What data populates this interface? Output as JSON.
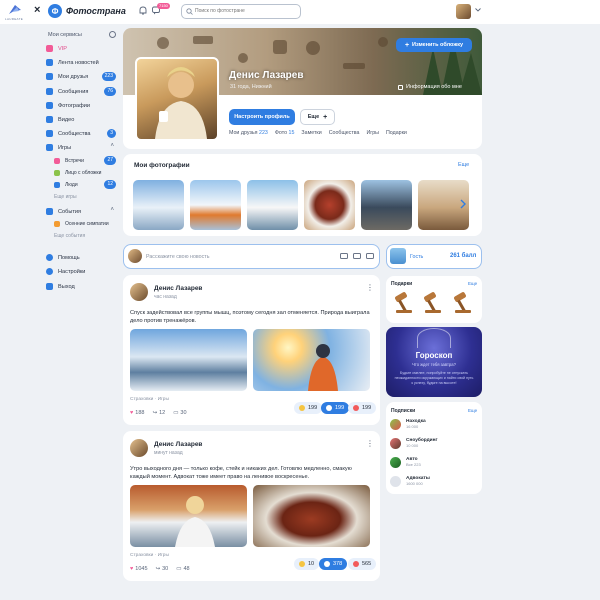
{
  "header": {
    "logo_text": "Фотострана",
    "notif_count": "7150",
    "search_placeholder": "Поиск по фотостране",
    "partner_caption": "LAUREATE"
  },
  "sidebar": {
    "title": "Мои сервисы",
    "items": [
      {
        "label": "VIP",
        "badge": ""
      },
      {
        "label": "Лента новостей",
        "badge": ""
      },
      {
        "label": "Мои друзья",
        "badge": "223"
      },
      {
        "label": "Сообщения",
        "badge": "76"
      },
      {
        "label": "Фотографии",
        "badge": ""
      },
      {
        "label": "Видео",
        "badge": ""
      },
      {
        "label": "Сообщества",
        "badge": "3"
      },
      {
        "label": "Игры",
        "badge": ""
      }
    ],
    "games": [
      {
        "label": "Встречи",
        "badge": "27"
      },
      {
        "label": "Лицо с обложки",
        "badge": ""
      },
      {
        "label": "Люди",
        "badge": "12"
      }
    ],
    "more_games": "Еще игры",
    "events_title": "События",
    "events": [
      {
        "label": "Осенние симпатии"
      }
    ],
    "more_events": "Еще события",
    "bottom": [
      {
        "label": "Помощь"
      },
      {
        "label": "Настройки"
      },
      {
        "label": "Выход"
      }
    ]
  },
  "profile": {
    "name": "Денис Лазарев",
    "info": "31 года, Нижний",
    "cover_button": "Изменить обложку",
    "profile_info_link": "Информация обо мне",
    "setup_button": "Настроить профиль",
    "more_button": "Еще",
    "tabs": [
      {
        "label": "Мои друзья",
        "count": "223"
      },
      {
        "label": "Фото",
        "count": "15"
      },
      {
        "label": "Заметки",
        "count": ""
      },
      {
        "label": "Сообщества",
        "count": ""
      },
      {
        "label": "Игры",
        "count": ""
      },
      {
        "label": "Подарки",
        "count": ""
      }
    ]
  },
  "photos": {
    "title": "Мои фотографии",
    "all_link": "Еще"
  },
  "composer": {
    "placeholder": "Расскажите свою новость"
  },
  "guest": {
    "label": "Гость",
    "points": "261 балл"
  },
  "posts": [
    {
      "author": "Денис Лазарев",
      "time": "час назад",
      "text": "Спуск задействовал все группы мышц, поэтому сегодня зал отменяется. Природа выиграла дело против тренажёров.",
      "meta": "Страховки · Игры",
      "likes": "188",
      "reposts": "12",
      "comments": "30",
      "reactions": [
        "199",
        "199",
        "199"
      ]
    },
    {
      "author": "Денис Лазарев",
      "time": "минут назад",
      "text": "Утро выходного дня — только кофе, стейк и никаких дел. Готовлю медленно, смакую каждый момент. Адвокат тоже имеет право на ленивое воскресенье.",
      "meta": "Страховки · Игры",
      "likes": "1045",
      "reposts": "30",
      "comments": "48",
      "reactions": [
        "10",
        "378",
        "565"
      ]
    }
  ],
  "gifts": {
    "title": "Подарки",
    "link": "Еще"
  },
  "horoscope": {
    "title": "Гороскоп",
    "subtitle": "Что ждет тебя завтра?",
    "text": "Будьте смелее, попробуйте не отпускать неожиданности окружающих и найти свой путь к успеху, будьте на высоте!"
  },
  "subscriptions": {
    "title": "Подписки",
    "link": "Еще",
    "items": [
      {
        "name": "Находка",
        "count": "16 000"
      },
      {
        "name": "Сноубординг",
        "count": "10 000"
      },
      {
        "name": "Авто",
        "count": "Все 223"
      },
      {
        "name": "Адвокаты",
        "count": "1600 000"
      }
    ]
  }
}
